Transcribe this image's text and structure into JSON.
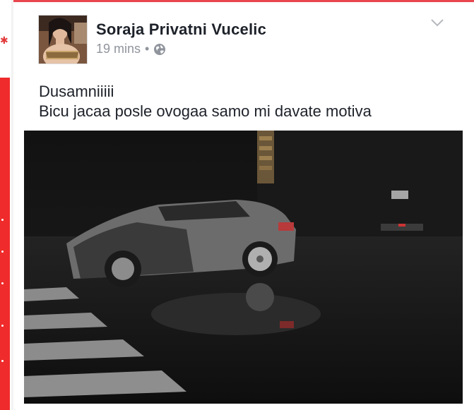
{
  "post": {
    "author": "Soraja Privatni Vucelic",
    "time": "19 mins",
    "separator": "•",
    "privacy_icon": "globe-icon",
    "menu_icon": "chevron-down-icon",
    "text_line1": "Dusamniiiii",
    "text_line2": "Bicu jacaa posle ovogaa samo mi davate motiva"
  },
  "colors": {
    "accent": "#e9474f",
    "text": "#1d2129",
    "meta": "#90949c"
  }
}
